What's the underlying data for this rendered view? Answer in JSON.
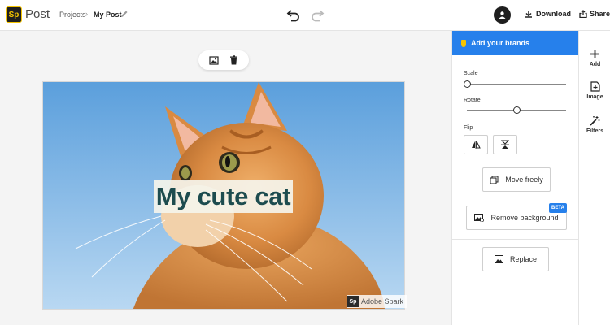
{
  "header": {
    "app_logo": "Sp",
    "app_name": "Post",
    "breadcrumb_parent": "Projects",
    "breadcrumb_separator": "›",
    "breadcrumb_current": "My Post",
    "download_label": "Download",
    "share_label": "Share"
  },
  "canvas": {
    "caption": "My cute cat",
    "watermark_logo": "Sp",
    "watermark_text": "Adobe Spark"
  },
  "panel": {
    "brand_label": "Add your brands",
    "scale_label": "Scale",
    "scale_value": 0.0,
    "rotate_label": "Rotate",
    "rotate_value": 0.5,
    "flip_label": "Flip",
    "move_freely_label": "Move freely",
    "remove_background_label": "Remove background",
    "beta_badge": "BETA",
    "replace_label": "Replace"
  },
  "side_tools": {
    "add_label": "Add",
    "image_label": "Image",
    "filters_label": "Filters"
  },
  "colors": {
    "accent": "#2680eb",
    "brand_yellow": "#f4c400",
    "caption_text": "#1d4c4f"
  }
}
